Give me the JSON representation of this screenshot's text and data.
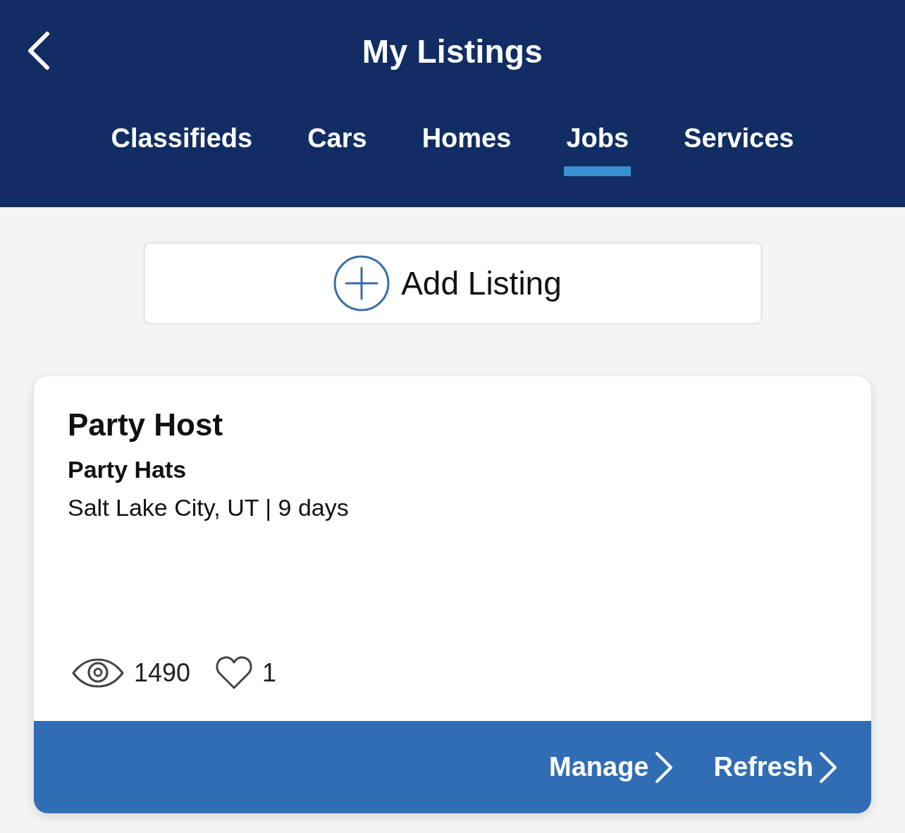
{
  "header": {
    "title": "My Listings"
  },
  "tabs": [
    {
      "label": "Classifieds",
      "selected": false
    },
    {
      "label": "Cars",
      "selected": false
    },
    {
      "label": "Homes",
      "selected": false
    },
    {
      "label": "Jobs",
      "selected": true
    },
    {
      "label": "Services",
      "selected": false
    }
  ],
  "add_button": {
    "label": "Add Listing"
  },
  "listings": [
    {
      "title": "Party Host",
      "company": "Party Hats",
      "details": "Salt Lake City, UT | 9 days",
      "views": "1490",
      "favorites": "1",
      "actions": [
        "Manage",
        "Refresh"
      ]
    }
  ]
}
